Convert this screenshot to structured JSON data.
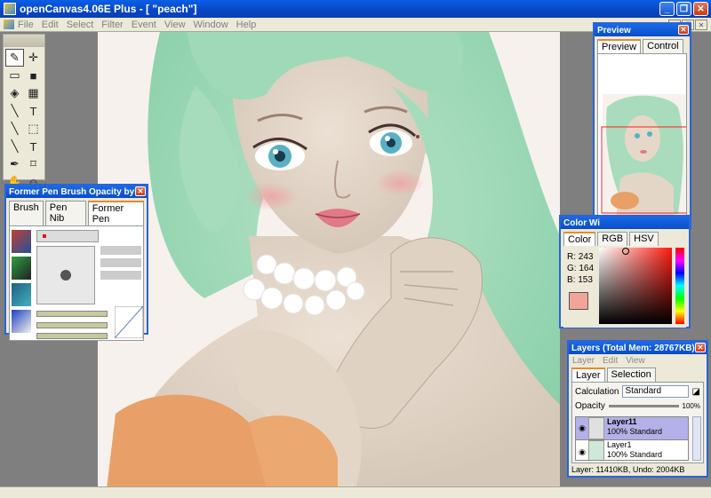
{
  "window": {
    "title": "openCanvas4.06E Plus - [ \"peach\"]",
    "btn_min": "_",
    "btn_max": "❐",
    "btn_close": "✕"
  },
  "menu": [
    "File",
    "Edit",
    "Select",
    "Filter",
    "Event",
    "View",
    "Window",
    "Help"
  ],
  "tools": [
    "✎",
    "✛",
    "▭",
    "■",
    "◈",
    "▦",
    "╲",
    "T",
    "╲",
    "⬚",
    "╲",
    "T",
    "✒",
    "⌑",
    "✋",
    "☺"
  ],
  "brush_panel": {
    "title": "Former Pen  Brush Opacity by ...",
    "tabs": [
      "Brush",
      "Pen Nib",
      "Former Pen"
    ],
    "active_tab": "Former Pen"
  },
  "preview_panel": {
    "title": "Preview",
    "tabs": [
      "Preview",
      "Control"
    ],
    "active_tab": "Preview"
  },
  "color_panel": {
    "title": "Color Wi",
    "tabs": [
      "Color",
      "RGB",
      "HSV"
    ],
    "active_tab": "Color",
    "r_label": "R: 243",
    "g_label": "G: 164",
    "b_label": "B: 153",
    "current_color": "#f3a499"
  },
  "layers_panel": {
    "title": "Layers (Total Mem: 28767KB)",
    "menu": [
      "Layer",
      "Edit",
      "View"
    ],
    "tabs": [
      "Layer",
      "Selection"
    ],
    "active_tab": "Layer",
    "calc_label": "Calculation",
    "calc_value": "Standard",
    "opacity_label": "Opacity",
    "opacity_value": "100%",
    "layers": [
      {
        "name": "Layer11",
        "mode": "100% Standard",
        "selected": true
      },
      {
        "name": "Layer1",
        "mode": "100% Standard",
        "selected": false
      }
    ],
    "status": "Layer: 11410KB, Undo: 2004KB"
  }
}
